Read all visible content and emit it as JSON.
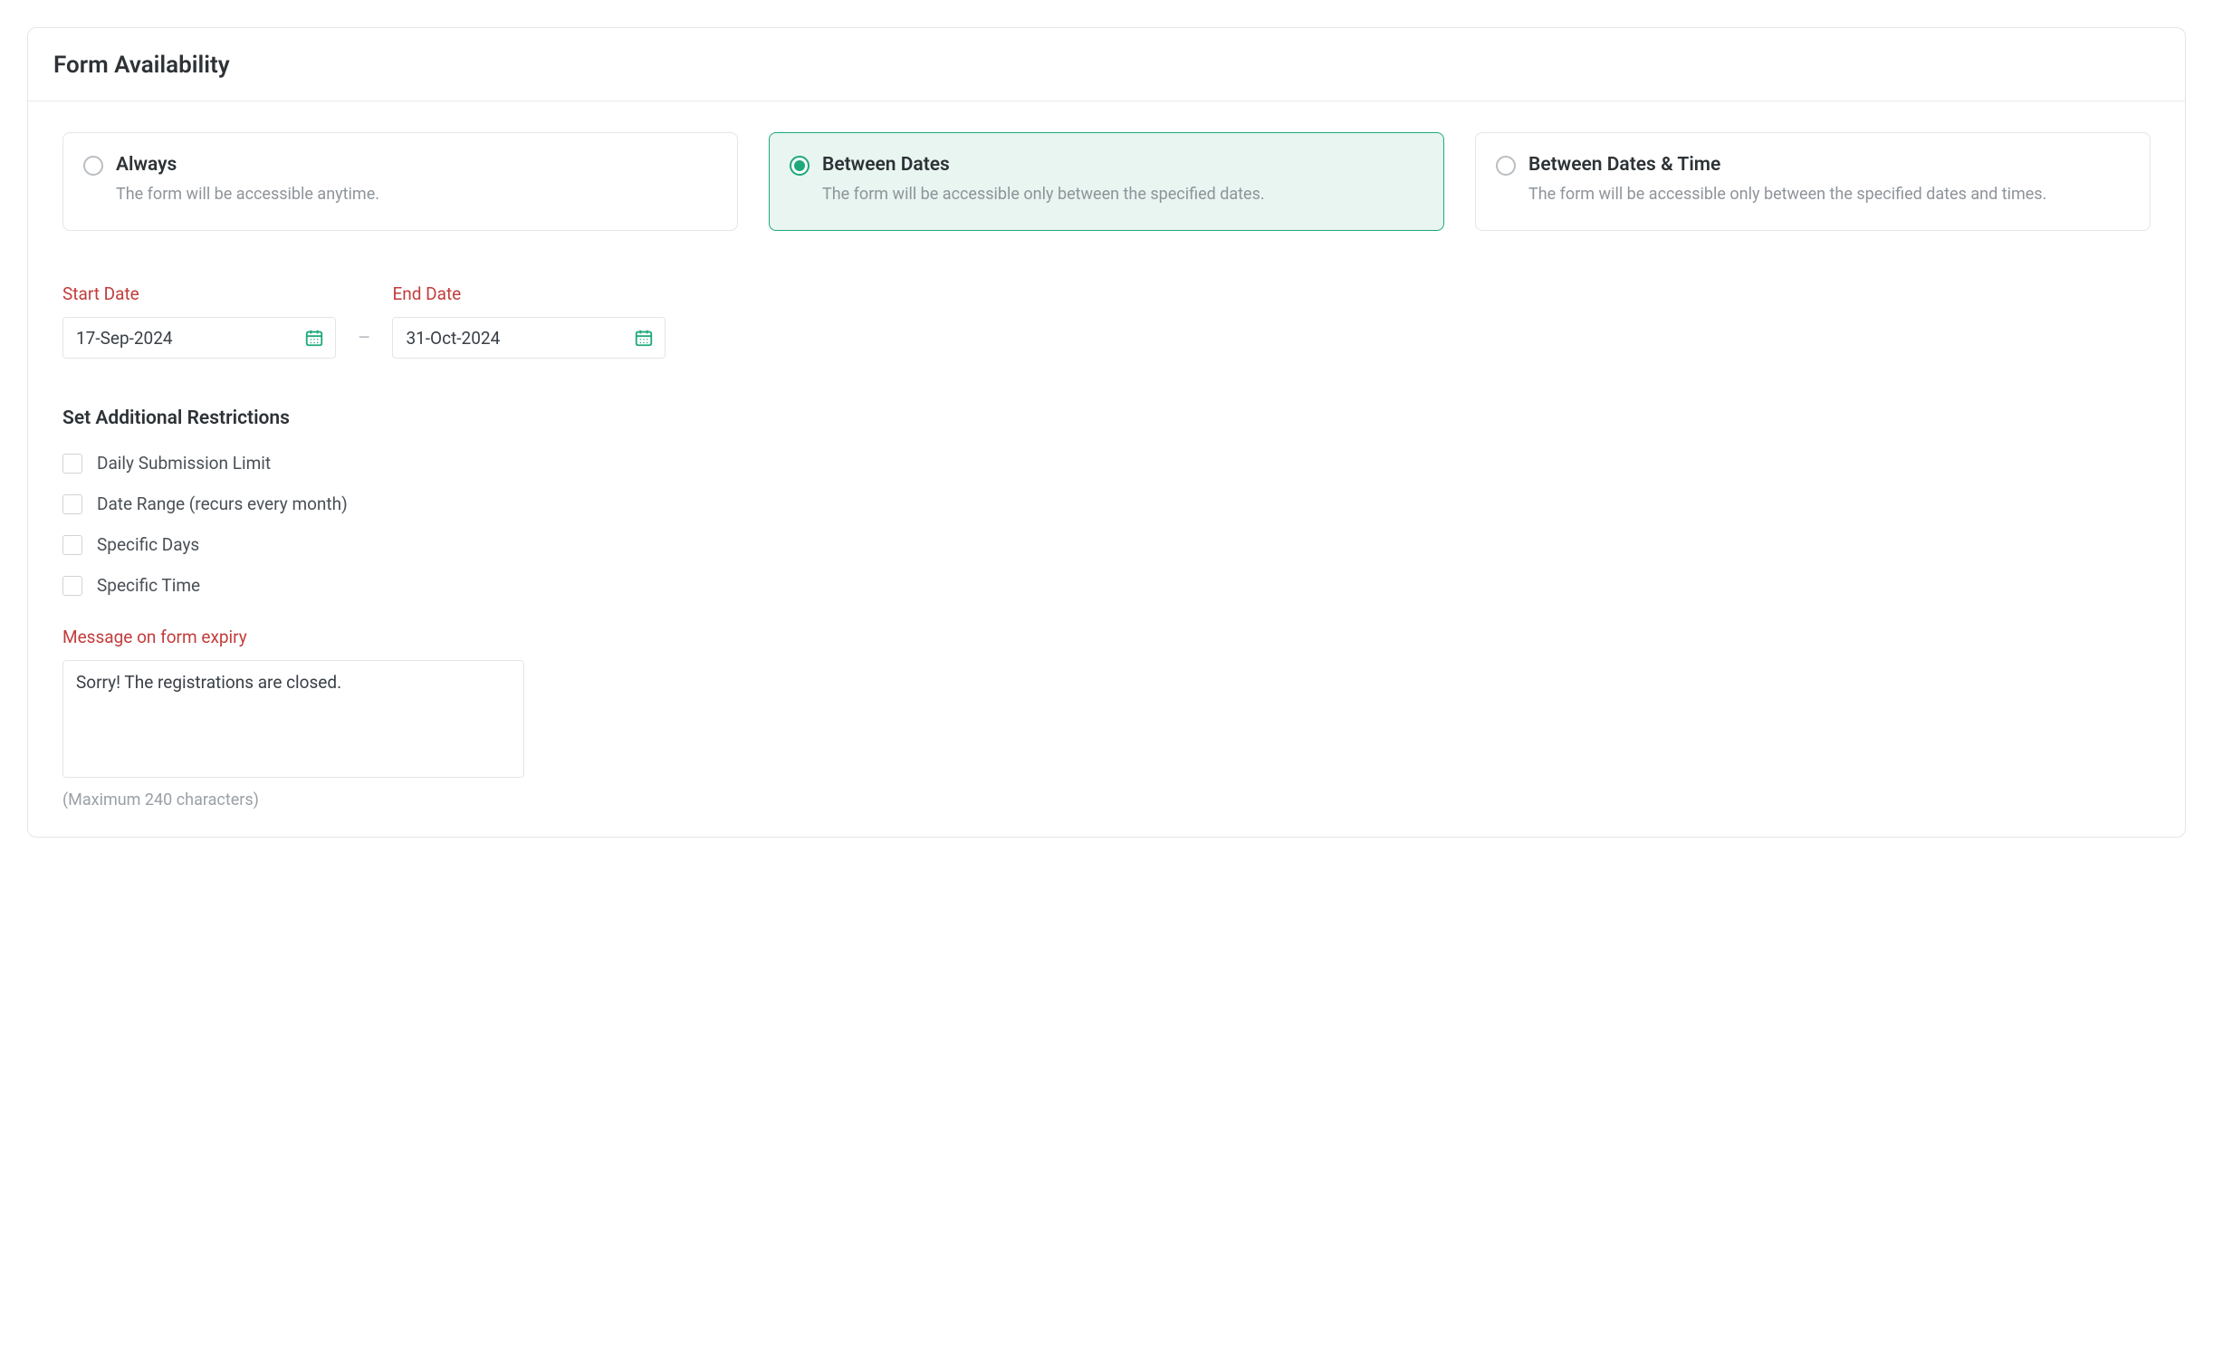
{
  "panel": {
    "title": "Form Availability"
  },
  "options": {
    "always": {
      "title": "Always",
      "desc": "The form will be accessible anytime."
    },
    "between_dates": {
      "title": "Between Dates",
      "desc": "The form will be accessible only between the specified dates."
    },
    "between_dates_time": {
      "title": "Between Dates & Time",
      "desc": "The form will be accessible only between the specified dates and times."
    }
  },
  "dates": {
    "start_label": "Start Date",
    "end_label": "End Date",
    "start_value": "17-Sep-2024",
    "end_value": "31-Oct-2024",
    "separator": "–"
  },
  "restrictions": {
    "heading": "Set Additional Restrictions",
    "items": {
      "daily_limit": "Daily Submission Limit",
      "date_range": "Date Range (recurs every month)",
      "specific_days": "Specific Days",
      "specific_time": "Specific Time"
    }
  },
  "message": {
    "label": "Message on form expiry",
    "value": "Sorry! The registrations are closed.",
    "hint": "(Maximum 240 characters)"
  },
  "colors": {
    "accent": "#1ea97c",
    "error_label": "#c33c3c"
  }
}
